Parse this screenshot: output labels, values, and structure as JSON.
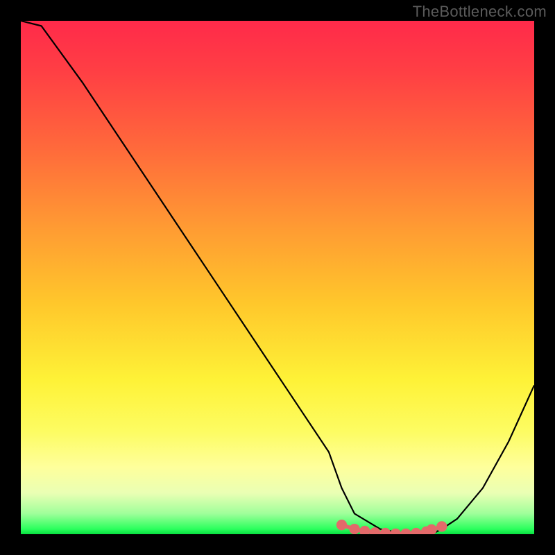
{
  "watermark": "TheBottleneck.com",
  "chart_data": {
    "type": "line",
    "title": "",
    "xlabel": "",
    "ylabel": "",
    "xlim": [
      0,
      100
    ],
    "ylim": [
      0,
      100
    ],
    "grid": false,
    "series": [
      {
        "name": "bottleneck-curve",
        "color": "#000000",
        "x": [
          0,
          4,
          12,
          20,
          28,
          36,
          44,
          52,
          60,
          62.5,
          65,
          70,
          75,
          80,
          82,
          85,
          90,
          95,
          100
        ],
        "values": [
          100,
          99,
          88,
          76,
          64,
          52,
          40,
          28,
          16,
          9,
          4,
          1,
          0,
          0,
          1,
          3,
          9,
          18,
          29
        ]
      }
    ],
    "flat_zone": {
      "color": "#e36a6a",
      "dot_radius": 0.7,
      "x": [
        62.5,
        65,
        67,
        69,
        71,
        73,
        75,
        77,
        79,
        80,
        82
      ],
      "values": [
        1.8,
        1.0,
        0.6,
        0.3,
        0.2,
        0.1,
        0.1,
        0.2,
        0.5,
        0.9,
        1.5
      ]
    },
    "gradient_stops": [
      {
        "pct": 0,
        "color": "#ff2a4a"
      },
      {
        "pct": 10,
        "color": "#ff3f44"
      },
      {
        "pct": 25,
        "color": "#ff6a3b"
      },
      {
        "pct": 40,
        "color": "#ff9a33"
      },
      {
        "pct": 55,
        "color": "#ffc72b"
      },
      {
        "pct": 70,
        "color": "#fef237"
      },
      {
        "pct": 80,
        "color": "#fdfc62"
      },
      {
        "pct": 87,
        "color": "#feff9c"
      },
      {
        "pct": 92,
        "color": "#eaffb4"
      },
      {
        "pct": 96,
        "color": "#9fff9a"
      },
      {
        "pct": 99,
        "color": "#2bff5d"
      },
      {
        "pct": 100,
        "color": "#08e040"
      }
    ]
  }
}
